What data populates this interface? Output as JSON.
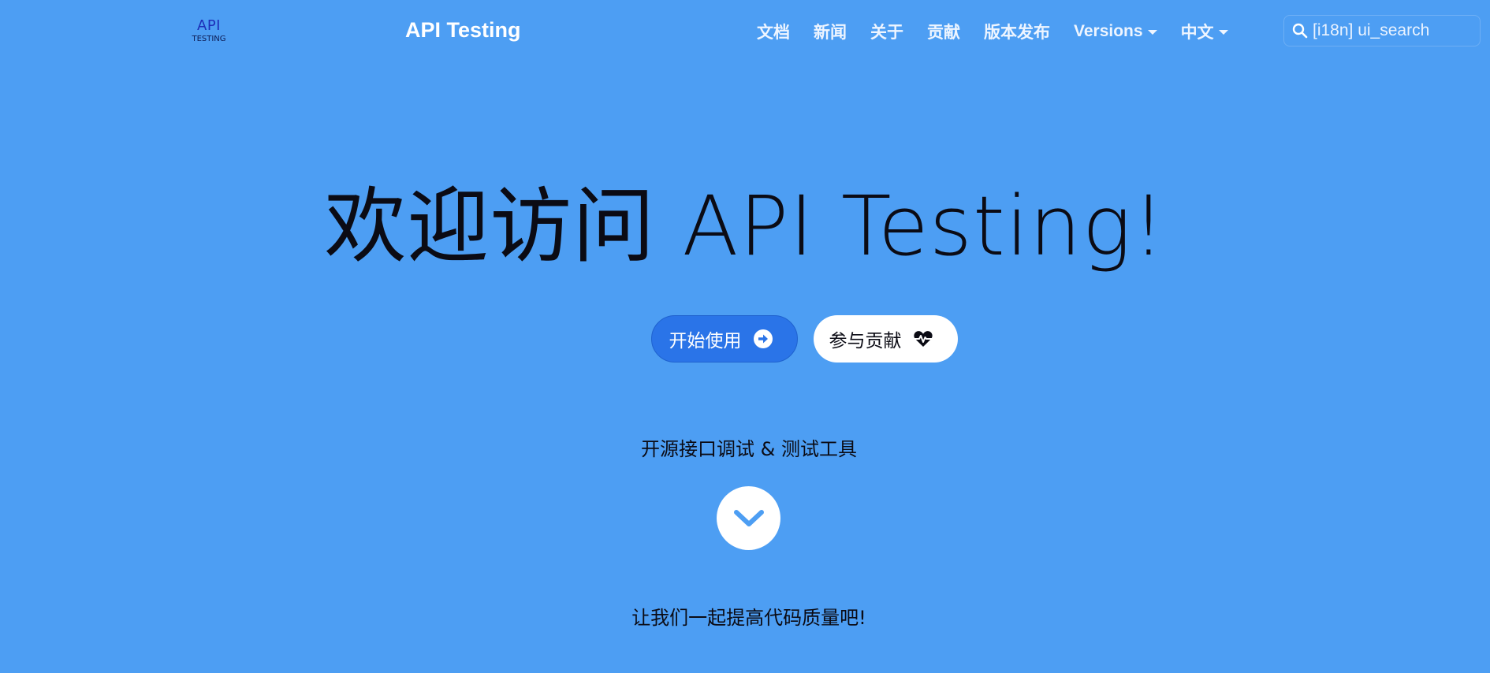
{
  "navbar": {
    "logo": {
      "line1": "API",
      "line2": "TESTING"
    },
    "brand": "API Testing",
    "items": [
      {
        "label": "文档"
      },
      {
        "label": "新闻"
      },
      {
        "label": "关于"
      },
      {
        "label": "贡献"
      },
      {
        "label": "版本发布"
      },
      {
        "label": "Versions",
        "dropdown": true
      },
      {
        "label": "中文",
        "dropdown": true
      }
    ],
    "search": {
      "placeholder": "[i18n] ui_search",
      "icon": "search-icon"
    }
  },
  "hero": {
    "title": "欢迎访问 API Testing!",
    "primary_button": {
      "label": "开始使用",
      "icon": "arrow-circle-right-icon"
    },
    "secondary_button": {
      "label": "参与贡献",
      "icon": "heartbeat-icon"
    },
    "tagline": "开源接口调试 & 测试工具",
    "scroll_icon": "chevron-down-icon",
    "footer_text": "让我们一起提高代码质量吧!"
  },
  "colors": {
    "background": "#4d9ef3",
    "primary_button": "#2a74e8",
    "text_dark": "#0b0b14",
    "nav_text": "#eef5ff",
    "logo_blue": "#1d2fb8"
  }
}
